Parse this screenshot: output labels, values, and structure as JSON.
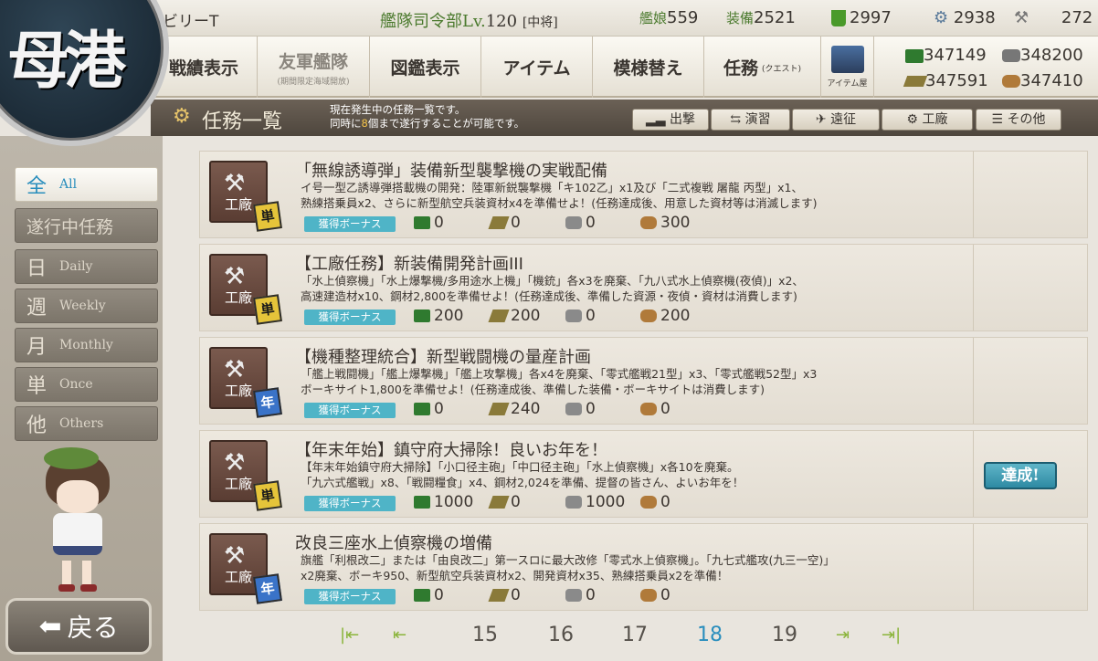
{
  "header": {
    "port_label": "母港",
    "player_name": "ビリーT",
    "hq_label": "艦隊司令部Lv.",
    "hq_level": "120",
    "rank": "[中将]",
    "ships_label": "艦娘",
    "ships_count": "559",
    "equip_label": "装備",
    "equip_count": "2521",
    "bucket": "2997",
    "devmat": "2938",
    "screw": "272"
  },
  "nav": {
    "items": [
      {
        "label": "戦績表示",
        "sub": ""
      },
      {
        "label": "友軍艦隊",
        "sub": "(期間限定海域開放)"
      },
      {
        "label": "図鑑表示",
        "sub": ""
      },
      {
        "label": "アイテム",
        "sub": ""
      },
      {
        "label": "模様替え",
        "sub": ""
      },
      {
        "label": "任務",
        "sub": "(クエスト)"
      }
    ],
    "item_shop": "アイテム屋"
  },
  "resources": {
    "fuel": "347149",
    "steel": "348200",
    "ammo": "347591",
    "bauxite": "347410"
  },
  "subbar": {
    "title": "任務一覧",
    "line1": "現在発生中の任務一覧です。",
    "line2_a": "同時に",
    "line2_num": "8",
    "line2_b": "個まで遂行することが可能です。",
    "tabs": [
      "出撃",
      "演習",
      "遠征",
      "工廠",
      "その他"
    ]
  },
  "left_tabs": [
    {
      "k": "全",
      "label": "All"
    },
    {
      "k": "",
      "label": "遂行中任務"
    },
    {
      "k": "日",
      "label": "Daily"
    },
    {
      "k": "週",
      "label": "Weekly"
    },
    {
      "k": "月",
      "label": "Monthly"
    },
    {
      "k": "単",
      "label": "Once"
    },
    {
      "k": "他",
      "label": "Others"
    }
  ],
  "quests": [
    {
      "category": "工廠",
      "badge": "単",
      "title": "「無線誘導弾」装備新型襲撃機の実戦配備",
      "desc1": "イ号一型乙誘導弾搭載機の開発：陸軍新鋭襲撃機「キ102乙」x1及び「二式複戦 屠龍 丙型」x1、",
      "desc2": "熟練搭乗員x2、さらに新型航空兵装資材x4を準備せよ！(任務達成後、用意した資材等は消滅します)",
      "bonus": "獲得ボーナス",
      "fuel": "0",
      "ammo": "0",
      "steel": "0",
      "bauxite": "300",
      "status": ""
    },
    {
      "category": "工廠",
      "badge": "単",
      "title": "【工廠任務】新装備開発計画III",
      "desc1": "「水上偵察機」「水上爆撃機/多用途水上機」「機銃」各x3を廃棄、「九八式水上偵察機(夜偵)」x2、",
      "desc2": "高速建造材x10、鋼材2,800を準備せよ！(任務達成後、準備した資源・夜偵・資材は消費します)",
      "bonus": "獲得ボーナス",
      "fuel": "200",
      "ammo": "200",
      "steel": "0",
      "bauxite": "200",
      "status": ""
    },
    {
      "category": "工廠",
      "badge": "年",
      "title": "【機種整理統合】新型戦闘機の量産計画",
      "desc1": "「艦上戦闘機」「艦上爆撃機」「艦上攻撃機」各x4を廃棄、「零式艦戦21型」x3、「零式艦戦52型」x3",
      "desc2": "ボーキサイト1,800を準備せよ！(任務達成後、準備した装備・ボーキサイトは消費します)",
      "bonus": "獲得ボーナス",
      "fuel": "0",
      "ammo": "240",
      "steel": "0",
      "bauxite": "0",
      "status": ""
    },
    {
      "category": "工廠",
      "badge": "単",
      "title": "【年末年始】鎮守府大掃除！良いお年を！",
      "desc1": "【年末年始鎮守府大掃除】「小口径主砲」「中口径主砲」「水上偵察機」x各10を廃棄。",
      "desc2": "「九六式艦戦」x8、「戦闘糧食」x4、鋼材2,024を準備、提督の皆さん、よいお年を！",
      "bonus": "獲得ボーナス",
      "fuel": "1000",
      "ammo": "0",
      "steel": "1000",
      "bauxite": "0",
      "status": "達成!"
    },
    {
      "category": "工廠",
      "badge": "年",
      "title": "改良三座水上偵察機の増備",
      "desc1": "旗艦「利根改二」または「由良改二」第一スロに最大改修「零式水上偵察機」。「九七式艦攻(九三一空)」",
      "desc2": "x2廃棄、ボーキ950、新型航空兵装資材x2、開発資材x35、熟練搭乗員x2を準備！",
      "bonus": "獲得ボーナス",
      "fuel": "0",
      "ammo": "0",
      "steel": "0",
      "bauxite": "0",
      "status": ""
    }
  ],
  "pager": {
    "pages": [
      "15",
      "16",
      "17",
      "18",
      "19"
    ],
    "current": "18"
  },
  "back_label": "戻る"
}
